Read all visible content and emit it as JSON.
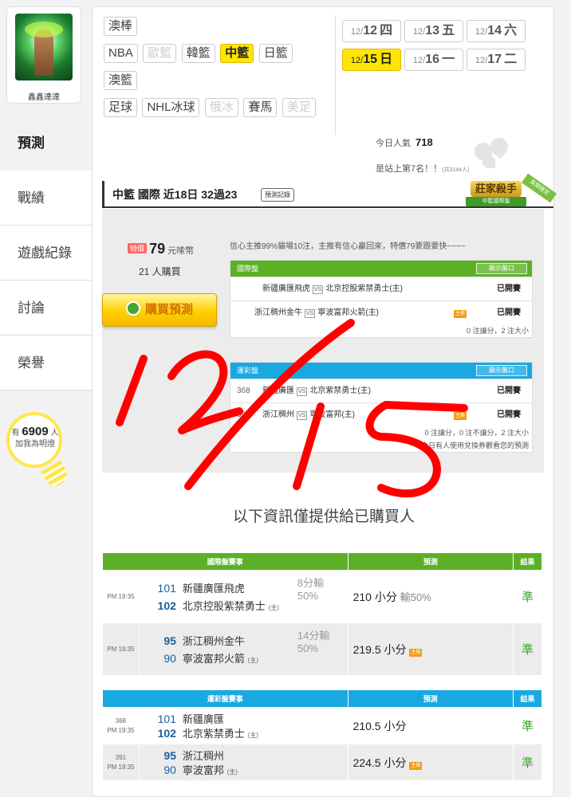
{
  "user": {
    "name": "鑫鑫達達"
  },
  "nav": {
    "items": [
      "預測",
      "戰績",
      "遊戲紀錄",
      "討論",
      "榮譽"
    ]
  },
  "likes": {
    "prefix": "有",
    "count": "6909",
    "suffix": "人",
    "caption": "加我為明燈"
  },
  "categories": [
    {
      "label": "澳棒",
      "state": "normal"
    },
    {
      "label": "NBA",
      "state": "normal"
    },
    {
      "label": "歐籃",
      "state": "dim"
    },
    {
      "label": "韓籃",
      "state": "normal"
    },
    {
      "label": "中籃",
      "state": "active"
    },
    {
      "label": "日籃",
      "state": "normal"
    },
    {
      "label": "澳籃",
      "state": "normal"
    },
    {
      "label": "足球",
      "state": "normal"
    },
    {
      "label": "NHL冰球",
      "state": "normal"
    },
    {
      "label": "俄冰",
      "state": "dim"
    },
    {
      "label": "賽馬",
      "state": "normal"
    },
    {
      "label": "美足",
      "state": "dim"
    }
  ],
  "dates": [
    {
      "prefix": "12/",
      "day": "12",
      "weekday": "四",
      "active": false
    },
    {
      "prefix": "12/",
      "day": "13",
      "weekday": "五",
      "active": false
    },
    {
      "prefix": "12/",
      "day": "14",
      "weekday": "六",
      "active": false
    },
    {
      "prefix": "12/",
      "day": "15",
      "weekday": "日",
      "active": true
    },
    {
      "prefix": "12/",
      "day": "16",
      "weekday": "一",
      "active": false
    },
    {
      "prefix": "12/",
      "day": "17",
      "weekday": "二",
      "active": false
    }
  ],
  "popularity": {
    "label": "今日人氣",
    "value": "718"
  },
  "rank": {
    "text": "是站上第7名！！",
    "note": "(共3144人)"
  },
  "rec": {
    "title": "中籃 國際 近18日 32過23",
    "record_button": "預測記錄",
    "badge_top": "莊家殺手",
    "badge_bottom": "中籃國際盤",
    "badge_ribbon": "長期穩定",
    "price_tag": "特價",
    "price": "79",
    "price_unit": "元嗦幣",
    "buyers": "21 人購買",
    "buy_button": "購買預測",
    "note": "信心主推99%貓場10注，主推有信心贏回來，特價79要跟要快~~~~",
    "intl": {
      "header": "國際盤",
      "show_button": "顯示盤口",
      "rows": [
        {
          "num": "",
          "away": "新疆廣匯飛虎",
          "vs": "VS",
          "home": "北京控股紫禁勇士(主)",
          "mark": "",
          "status": "已開賽"
        },
        {
          "num": "",
          "away": "浙江稠州金牛",
          "vs": "VS",
          "home": "寧波富邦火箭(主)",
          "mark": "主推",
          "status": "已開賽"
        }
      ],
      "summary": "0 注讓分，2 注大小"
    },
    "lottery": {
      "header": "運彩盤",
      "show_button": "顯示盤口",
      "rows": [
        {
          "num": "368",
          "away": "新疆廣匯",
          "vs": "VS",
          "home": "北京紫禁勇士(主)",
          "mark": "",
          "status": "已開賽"
        },
        {
          "num": "391",
          "away": "浙江稠州",
          "vs": "VS",
          "home": "寧波富邦(主)",
          "mark": "主推",
          "status": "已開賽"
        }
      ],
      "summary": "0 注讓分，0 注不讓分，2 注大小",
      "summary2": "今日有人使用兌換券觀看您的預測"
    }
  },
  "purchased_notice": "以下資訊僅提供給已購買人",
  "intl_results": {
    "headers": [
      "國際盤賽事",
      "預測",
      "結果"
    ],
    "rows": [
      {
        "num": "",
        "time": "PM 19:35",
        "away_no": "101",
        "away": "新疆廣匯飛虎",
        "home_no": "102",
        "home": "北京控股紫禁勇士",
        "home_tag": "(主)",
        "handicap1": "8分輸",
        "handicap2": "50%",
        "pred": "210 小分",
        "pred_sub": "輸50%",
        "pred_tag": "",
        "result": "準"
      },
      {
        "num": "",
        "time": "PM 19:35",
        "away_no": "95",
        "away": "浙江稠州金牛",
        "home_no": "90",
        "home": "寧波富邦火箭",
        "home_tag": "(主)",
        "handicap1": "14分輸",
        "handicap2": "50%",
        "pred": "219.5 小分",
        "pred_sub": "",
        "pred_tag": "主推",
        "result": "準"
      }
    ]
  },
  "lottery_results": {
    "headers": [
      "運彩盤賽事",
      "預測",
      "結果"
    ],
    "rows": [
      {
        "num": "368",
        "time": "PM 19:35",
        "away_no": "101",
        "away": "新疆廣匯",
        "home_no": "102",
        "home": "北京紫禁勇士",
        "home_tag": "(主)",
        "handicap1": "",
        "handicap2": "",
        "pred": "210.5 小分",
        "pred_sub": "",
        "pred_tag": "",
        "result": "準"
      },
      {
        "num": "391",
        "time": "PM 19:35",
        "away_no": "95",
        "away": "浙江稠州",
        "home_no": "90",
        "home": "寧波富邦",
        "home_tag": "(主)",
        "handicap1": "",
        "handicap2": "",
        "pred": "224.5 小分",
        "pred_sub": "",
        "pred_tag": "主推",
        "result": "準"
      }
    ]
  },
  "handwriting": {
    "text": "12/15",
    "color": "#ff0000"
  }
}
